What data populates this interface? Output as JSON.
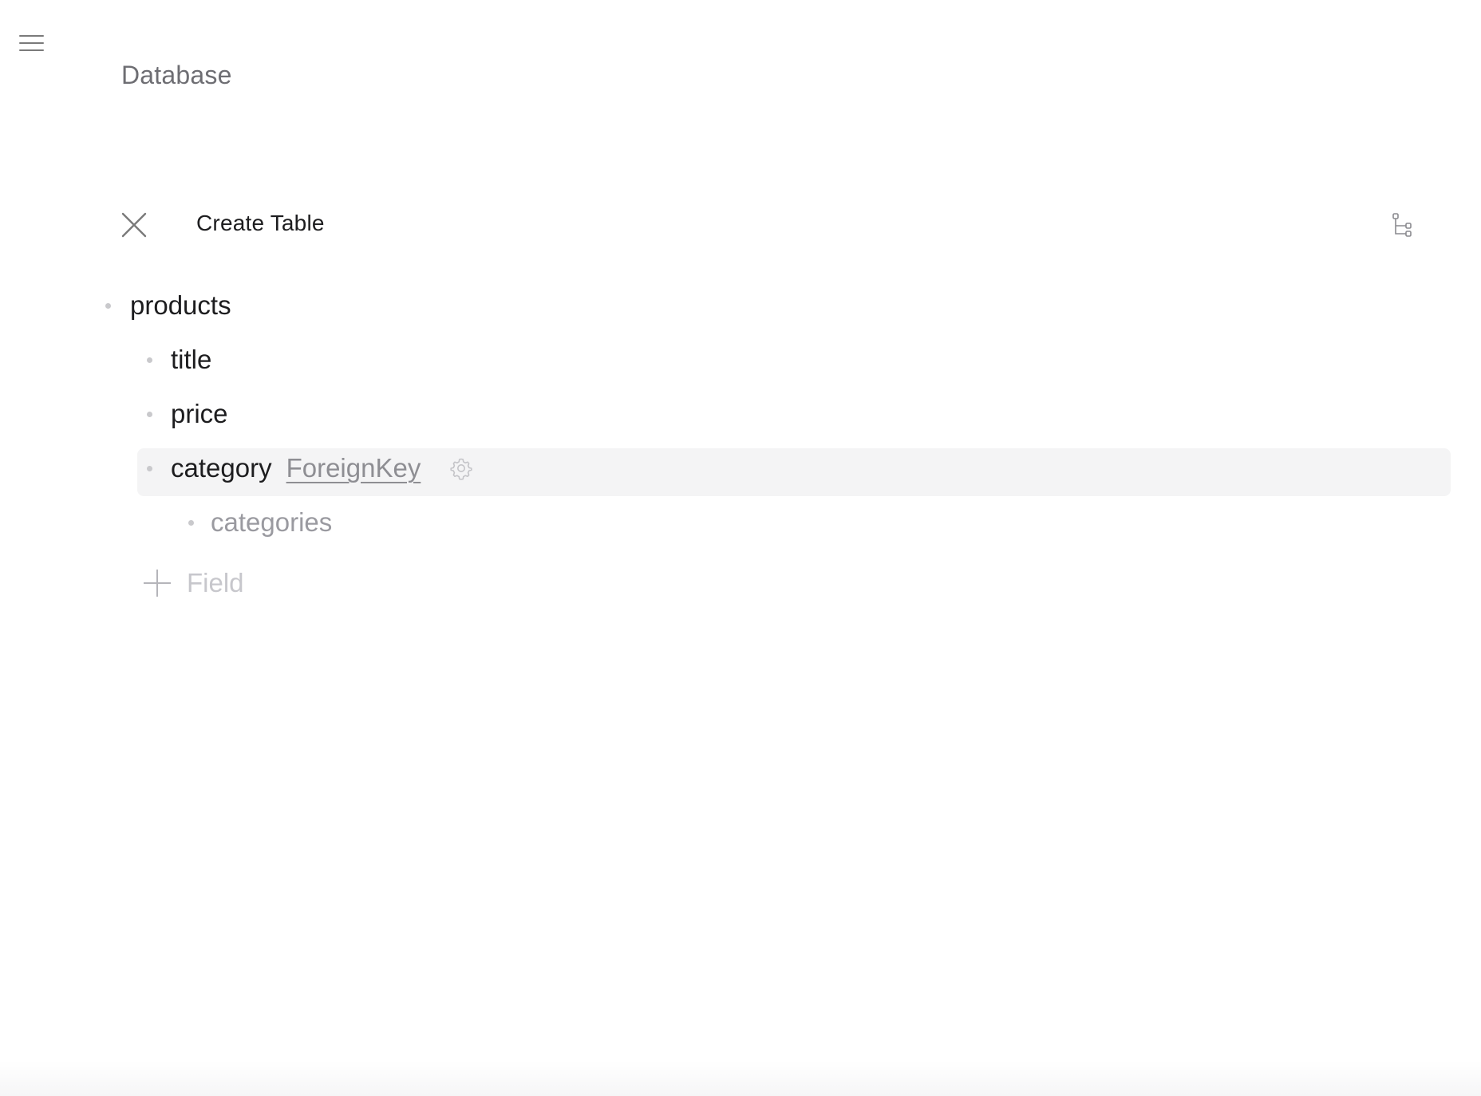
{
  "header": {
    "menu_icon": "hamburger-menu-icon",
    "breadcrumb": "Database"
  },
  "panel": {
    "title": "Create Table",
    "close_icon": "close-icon",
    "tree_view_icon": "tree-view-icon"
  },
  "table": {
    "name": "products",
    "fields": [
      {
        "name": "title"
      },
      {
        "name": "price"
      },
      {
        "name": "category",
        "type": "ForeignKey",
        "settings_icon": "gear-icon",
        "reference": "categories"
      }
    ]
  },
  "add_field": {
    "icon": "plus-icon",
    "label": "Field"
  },
  "colors": {
    "text_primary": "#1d1d1f",
    "text_muted": "#8e8e93",
    "highlight": "#f4f4f5"
  }
}
